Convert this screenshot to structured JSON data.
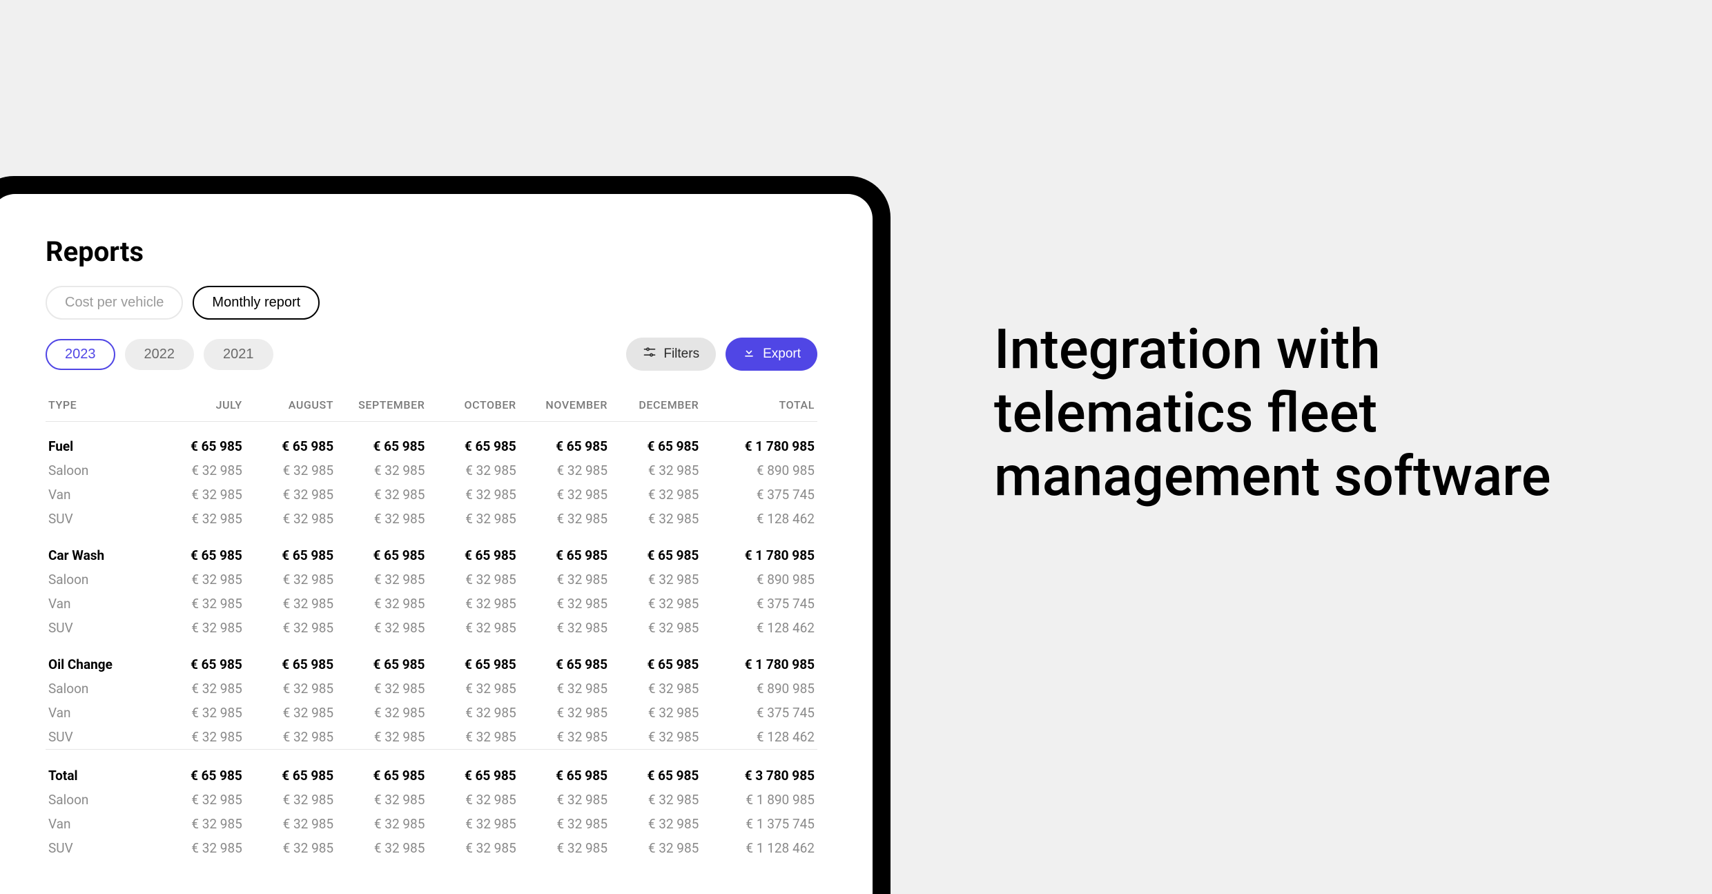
{
  "marketing": {
    "headline": "Integration with telematics fleet management software"
  },
  "page": {
    "title": "Reports"
  },
  "tabs": {
    "items": [
      {
        "label": "Cost per vehicle",
        "active": false
      },
      {
        "label": "Monthly report",
        "active": true
      }
    ]
  },
  "years": {
    "items": [
      {
        "label": "2023",
        "active": true
      },
      {
        "label": "2022",
        "active": false
      },
      {
        "label": "2021",
        "active": false
      }
    ]
  },
  "actions": {
    "filters_label": "Filters",
    "export_label": "Export"
  },
  "table": {
    "columns": [
      "TYPE",
      "JULY",
      "AUGUST",
      "SEPTEMBER",
      "OCTOBER",
      "NOVEMBER",
      "DECEMBER",
      "TOTAL"
    ],
    "groups": [
      {
        "name": "Fuel",
        "values": [
          "€ 65 985",
          "€ 65 985",
          "€ 65 985",
          "€ 65 985",
          "€ 65 985",
          "€ 65 985",
          "€ 1 780 985"
        ],
        "subs": [
          {
            "name": "Saloon",
            "values": [
              "€ 32 985",
              "€ 32 985",
              "€ 32 985",
              "€ 32 985",
              "€ 32 985",
              "€ 32 985",
              "€ 890 985"
            ]
          },
          {
            "name": "Van",
            "values": [
              "€ 32 985",
              "€ 32 985",
              "€ 32 985",
              "€ 32 985",
              "€ 32 985",
              "€ 32 985",
              "€ 375 745"
            ]
          },
          {
            "name": "SUV",
            "values": [
              "€ 32 985",
              "€ 32 985",
              "€ 32 985",
              "€ 32 985",
              "€ 32 985",
              "€ 32 985",
              "€ 128 462"
            ]
          }
        ]
      },
      {
        "name": "Car Wash",
        "values": [
          "€ 65 985",
          "€ 65 985",
          "€ 65 985",
          "€ 65 985",
          "€ 65 985",
          "€ 65 985",
          "€ 1 780 985"
        ],
        "subs": [
          {
            "name": "Saloon",
            "values": [
              "€ 32 985",
              "€ 32 985",
              "€ 32 985",
              "€ 32 985",
              "€ 32 985",
              "€ 32 985",
              "€ 890 985"
            ]
          },
          {
            "name": "Van",
            "values": [
              "€ 32 985",
              "€ 32 985",
              "€ 32 985",
              "€ 32 985",
              "€ 32 985",
              "€ 32 985",
              "€ 375 745"
            ]
          },
          {
            "name": "SUV",
            "values": [
              "€ 32 985",
              "€ 32 985",
              "€ 32 985",
              "€ 32 985",
              "€ 32 985",
              "€ 32 985",
              "€ 128 462"
            ]
          }
        ]
      },
      {
        "name": "Oil Change",
        "values": [
          "€ 65 985",
          "€ 65 985",
          "€ 65 985",
          "€ 65 985",
          "€ 65 985",
          "€ 65 985",
          "€ 1 780 985"
        ],
        "subs": [
          {
            "name": "Saloon",
            "values": [
              "€ 32 985",
              "€ 32 985",
              "€ 32 985",
              "€ 32 985",
              "€ 32 985",
              "€ 32 985",
              "€ 890 985"
            ]
          },
          {
            "name": "Van",
            "values": [
              "€ 32 985",
              "€ 32 985",
              "€ 32 985",
              "€ 32 985",
              "€ 32 985",
              "€ 32 985",
              "€ 375 745"
            ]
          },
          {
            "name": "SUV",
            "values": [
              "€ 32 985",
              "€ 32 985",
              "€ 32 985",
              "€ 32 985",
              "€ 32 985",
              "€ 32 985",
              "€ 128 462"
            ]
          }
        ]
      }
    ],
    "total": {
      "name": "Total",
      "values": [
        "€ 65 985",
        "€ 65 985",
        "€ 65 985",
        "€ 65 985",
        "€ 65 985",
        "€ 65 985",
        "€ 3 780 985"
      ],
      "subs": [
        {
          "name": "Saloon",
          "values": [
            "€ 32 985",
            "€ 32 985",
            "€ 32 985",
            "€ 32 985",
            "€ 32 985",
            "€ 32 985",
            "€ 1 890 985"
          ]
        },
        {
          "name": "Van",
          "values": [
            "€ 32 985",
            "€ 32 985",
            "€ 32 985",
            "€ 32 985",
            "€ 32 985",
            "€ 32 985",
            "€ 1 375 745"
          ]
        },
        {
          "name": "SUV",
          "values": [
            "€ 32 985",
            "€ 32 985",
            "€ 32 985",
            "€ 32 985",
            "€ 32 985",
            "€ 32 985",
            "€ 1 128 462"
          ]
        }
      ]
    }
  }
}
